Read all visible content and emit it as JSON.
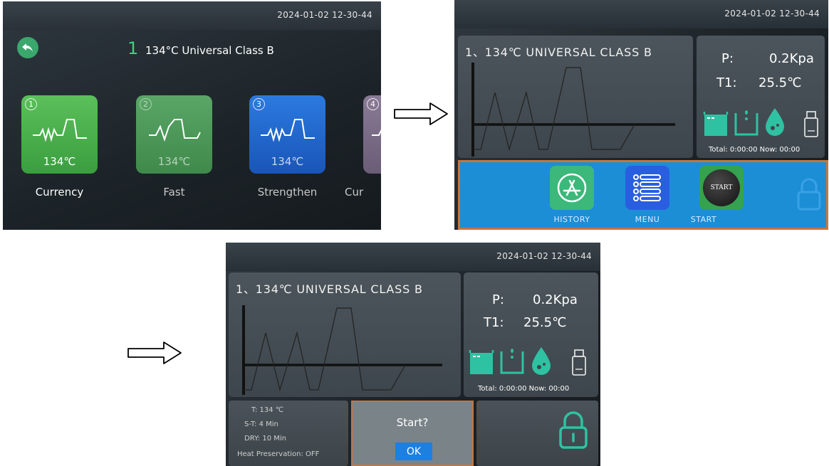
{
  "datetime": "2024-01-02  12-30-44",
  "screen1": {
    "program_number": "1",
    "program_name": "134°C Universal Class B",
    "tiles": [
      {
        "number": "1",
        "temp": "134℃",
        "label": "Currency",
        "color": "#44ad48"
      },
      {
        "number": "2",
        "temp": "134℃",
        "label": "Fast",
        "color": "#3a9c52"
      },
      {
        "number": "3",
        "temp": "134℃",
        "label": "Strengthen",
        "color": "#1f66c9"
      },
      {
        "number": "4",
        "temp": "",
        "label": "Cur",
        "color": "#7e6f8a"
      }
    ]
  },
  "main": {
    "title": "1、134℃ UNIVERSAL CLASS B",
    "pressure_label": "P:",
    "pressure_value": "0.2Kpa",
    "temp_label": "T1:",
    "temp_value": "25.5℃",
    "total_line": "Total: 0:00:00  Now:  00:00"
  },
  "dock": {
    "history": "HISTORY",
    "menu": "MENU",
    "start": "START",
    "start_icon_text": "START"
  },
  "info": {
    "t": "T:          134 ℃",
    "st": "S-T:          4 Min",
    "dry": "DRY:        10 Min",
    "heat": "Heat Preservation: OFF"
  },
  "dialog": {
    "message": "Start?",
    "ok": "OK"
  },
  "colors": {
    "accent_green": "#3bd37e",
    "icon_teal": "#2fc2a2",
    "dock_blue": "#1c8ed6",
    "dialog_border": "#c8763a"
  }
}
